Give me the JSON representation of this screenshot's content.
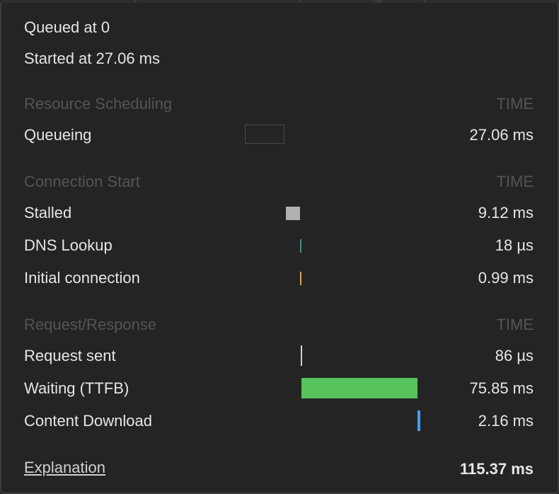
{
  "summary": {
    "queued": "Queued at 0",
    "started": "Started at 27.06 ms"
  },
  "sections": {
    "resource_scheduling": {
      "title": "Resource Scheduling",
      "time_header": "TIME",
      "rows": [
        {
          "label": "Queueing",
          "value": "27.06 ms"
        }
      ]
    },
    "connection_start": {
      "title": "Connection Start",
      "time_header": "TIME",
      "rows": [
        {
          "label": "Stalled",
          "value": "9.12 ms",
          "color": "#b0b0b0"
        },
        {
          "label": "DNS Lookup",
          "value": "18 µs",
          "color": "#2e9a8f"
        },
        {
          "label": "Initial connection",
          "value": "0.99 ms",
          "color": "#f0a040"
        }
      ]
    },
    "request_response": {
      "title": "Request/Response",
      "time_header": "TIME",
      "rows": [
        {
          "label": "Request sent",
          "value": "86 µs",
          "color": "#cfcfcf"
        },
        {
          "label": "Waiting (TTFB)",
          "value": "75.85 ms",
          "color": "#56c35c"
        },
        {
          "label": "Content Download",
          "value": "2.16 ms",
          "color": "#4a9ee8"
        }
      ]
    }
  },
  "footer": {
    "explanation": "Explanation",
    "total": "115.37 ms"
  }
}
